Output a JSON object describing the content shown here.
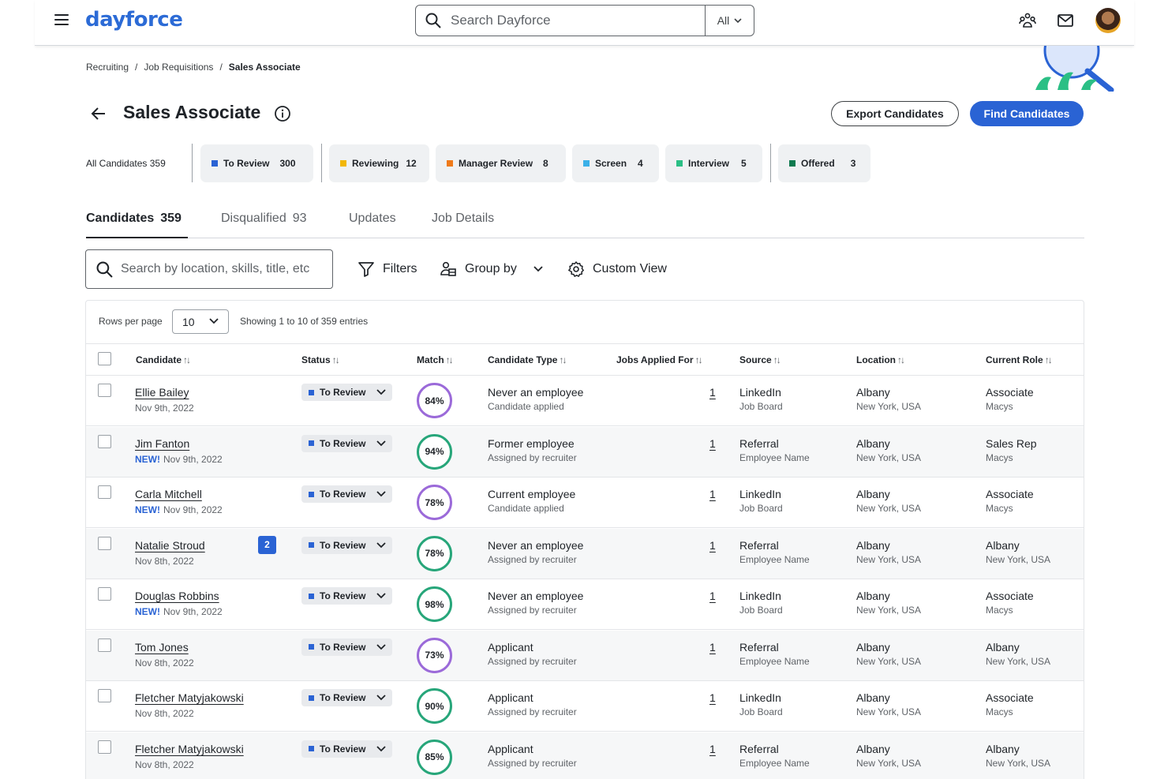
{
  "header": {
    "logo": "dayforce",
    "search_placeholder": "Search Dayforce",
    "search_scope": "All"
  },
  "breadcrumb": [
    "Recruiting",
    "Job Requisitions",
    "Sales Associate"
  ],
  "page": {
    "title": "Sales Associate",
    "export_label": "Export Candidates",
    "find_label": "Find Candidates"
  },
  "pipeline": {
    "all_label": "All Candidates",
    "all_count": "359",
    "stages": [
      {
        "label": "To Review",
        "count": "300",
        "color": "#2a63d4"
      },
      {
        "label": "Reviewing",
        "count": "12",
        "color": "#f2b705"
      },
      {
        "label": "Manager Review",
        "count": "8",
        "color": "#ef7a1a"
      },
      {
        "label": "Screen",
        "count": "4",
        "color": "#3bb0e8"
      },
      {
        "label": "Interview",
        "count": "5",
        "color": "#2bbf85"
      },
      {
        "label": "Offered",
        "count": "3",
        "color": "#0e7a4f"
      }
    ]
  },
  "tabs": [
    {
      "label": "Candidates",
      "count": "359"
    },
    {
      "label": "Disqualified",
      "count": "93"
    },
    {
      "label": "Updates",
      "count": ""
    },
    {
      "label": "Job Details",
      "count": ""
    }
  ],
  "toolbar": {
    "search_placeholder": "Search by location, skills, title, etc",
    "filters_label": "Filters",
    "group_by_label": "Group by",
    "custom_view_label": "Custom View"
  },
  "table": {
    "rows_per_page_label": "Rows per page",
    "rows_per_page_value": "10",
    "showing": "Showing 1 to 10 of 359 entries",
    "columns": [
      "Candidate",
      "Status",
      "Match",
      "Candidate Type",
      "Jobs Applied For",
      "Source",
      "Location",
      "Current Role"
    ],
    "rows": [
      {
        "name": "Ellie Bailey",
        "new": "",
        "date": "Nov 9th, 2022",
        "badge": "",
        "status": "To Review",
        "match": "84%",
        "match_color": "purple",
        "type": "Never an employee",
        "type_sub": "Candidate applied",
        "jobs": "1",
        "source": "LinkedIn",
        "source_sub": "Job Board",
        "location": "Albany",
        "location_sub": "New York, USA",
        "role": "Associate",
        "role_sub": "Macys"
      },
      {
        "name": "Jim Fanton",
        "new": "NEW!",
        "date": "Nov 9th, 2022",
        "badge": "",
        "status": "To Review",
        "match": "94%",
        "match_color": "green",
        "type": "Former employee",
        "type_sub": "Assigned by recruiter",
        "jobs": "1",
        "source": "Referral",
        "source_sub": "Employee Name",
        "location": "Albany",
        "location_sub": "New York, USA",
        "role": "Sales Rep",
        "role_sub": "Macys"
      },
      {
        "name": "Carla Mitchell",
        "new": "NEW!",
        "date": "Nov 9th, 2022",
        "badge": "",
        "status": "To Review",
        "match": "78%",
        "match_color": "purple",
        "type": "Current employee",
        "type_sub": "Candidate applied",
        "jobs": "1",
        "source": "LinkedIn",
        "source_sub": "Job Board",
        "location": "Albany",
        "location_sub": "New York, USA",
        "role": "Associate",
        "role_sub": "Macys"
      },
      {
        "name": "Natalie Stroud",
        "new": "",
        "date": "Nov 8th, 2022",
        "badge": "2",
        "status": "To Review",
        "match": "78%",
        "match_color": "green",
        "type": "Never an employee",
        "type_sub": "Assigned by recruiter",
        "jobs": "1",
        "source": "Referral",
        "source_sub": "Employee Name",
        "location": "Albany",
        "location_sub": "New York, USA",
        "role": "Albany",
        "role_sub": "New York, USA"
      },
      {
        "name": "Douglas Robbins",
        "new": "NEW!",
        "date": "Nov 9th, 2022",
        "badge": "",
        "status": "To Review",
        "match": "98%",
        "match_color": "green",
        "type": "Never an employee",
        "type_sub": "Assigned by recruiter",
        "jobs": "1",
        "source": "LinkedIn",
        "source_sub": "Job Board",
        "location": "Albany",
        "location_sub": "New York, USA",
        "role": "Associate",
        "role_sub": "Macys"
      },
      {
        "name": "Tom Jones",
        "new": "",
        "date": "Nov 8th, 2022",
        "badge": "",
        "status": "To Review",
        "match": "73%",
        "match_color": "purple",
        "type": "Applicant",
        "type_sub": "Assigned by recruiter",
        "jobs": "1",
        "source": "Referral",
        "source_sub": "Employee Name",
        "location": "Albany",
        "location_sub": "New York, USA",
        "role": "Albany",
        "role_sub": "New York, USA"
      },
      {
        "name": "Fletcher Matyjakowski",
        "new": "",
        "date": "Nov 8th, 2022",
        "badge": "",
        "status": "To Review",
        "match": "90%",
        "match_color": "green",
        "type": "Applicant",
        "type_sub": "Assigned by recruiter",
        "jobs": "1",
        "source": "LinkedIn",
        "source_sub": "Job Board",
        "location": "Albany",
        "location_sub": "New York, USA",
        "role": "Associate",
        "role_sub": "Macys"
      },
      {
        "name": "Fletcher Matyjakowski",
        "new": "",
        "date": "Nov 8th, 2022",
        "badge": "",
        "status": "To Review",
        "match": "85%",
        "match_color": "green",
        "type": "Applicant",
        "type_sub": "Assigned by recruiter",
        "jobs": "1",
        "source": "Referral",
        "source_sub": "Employee Name",
        "location": "Albany",
        "location_sub": "New York, USA",
        "role": "Albany",
        "role_sub": "New York, USA"
      }
    ]
  }
}
